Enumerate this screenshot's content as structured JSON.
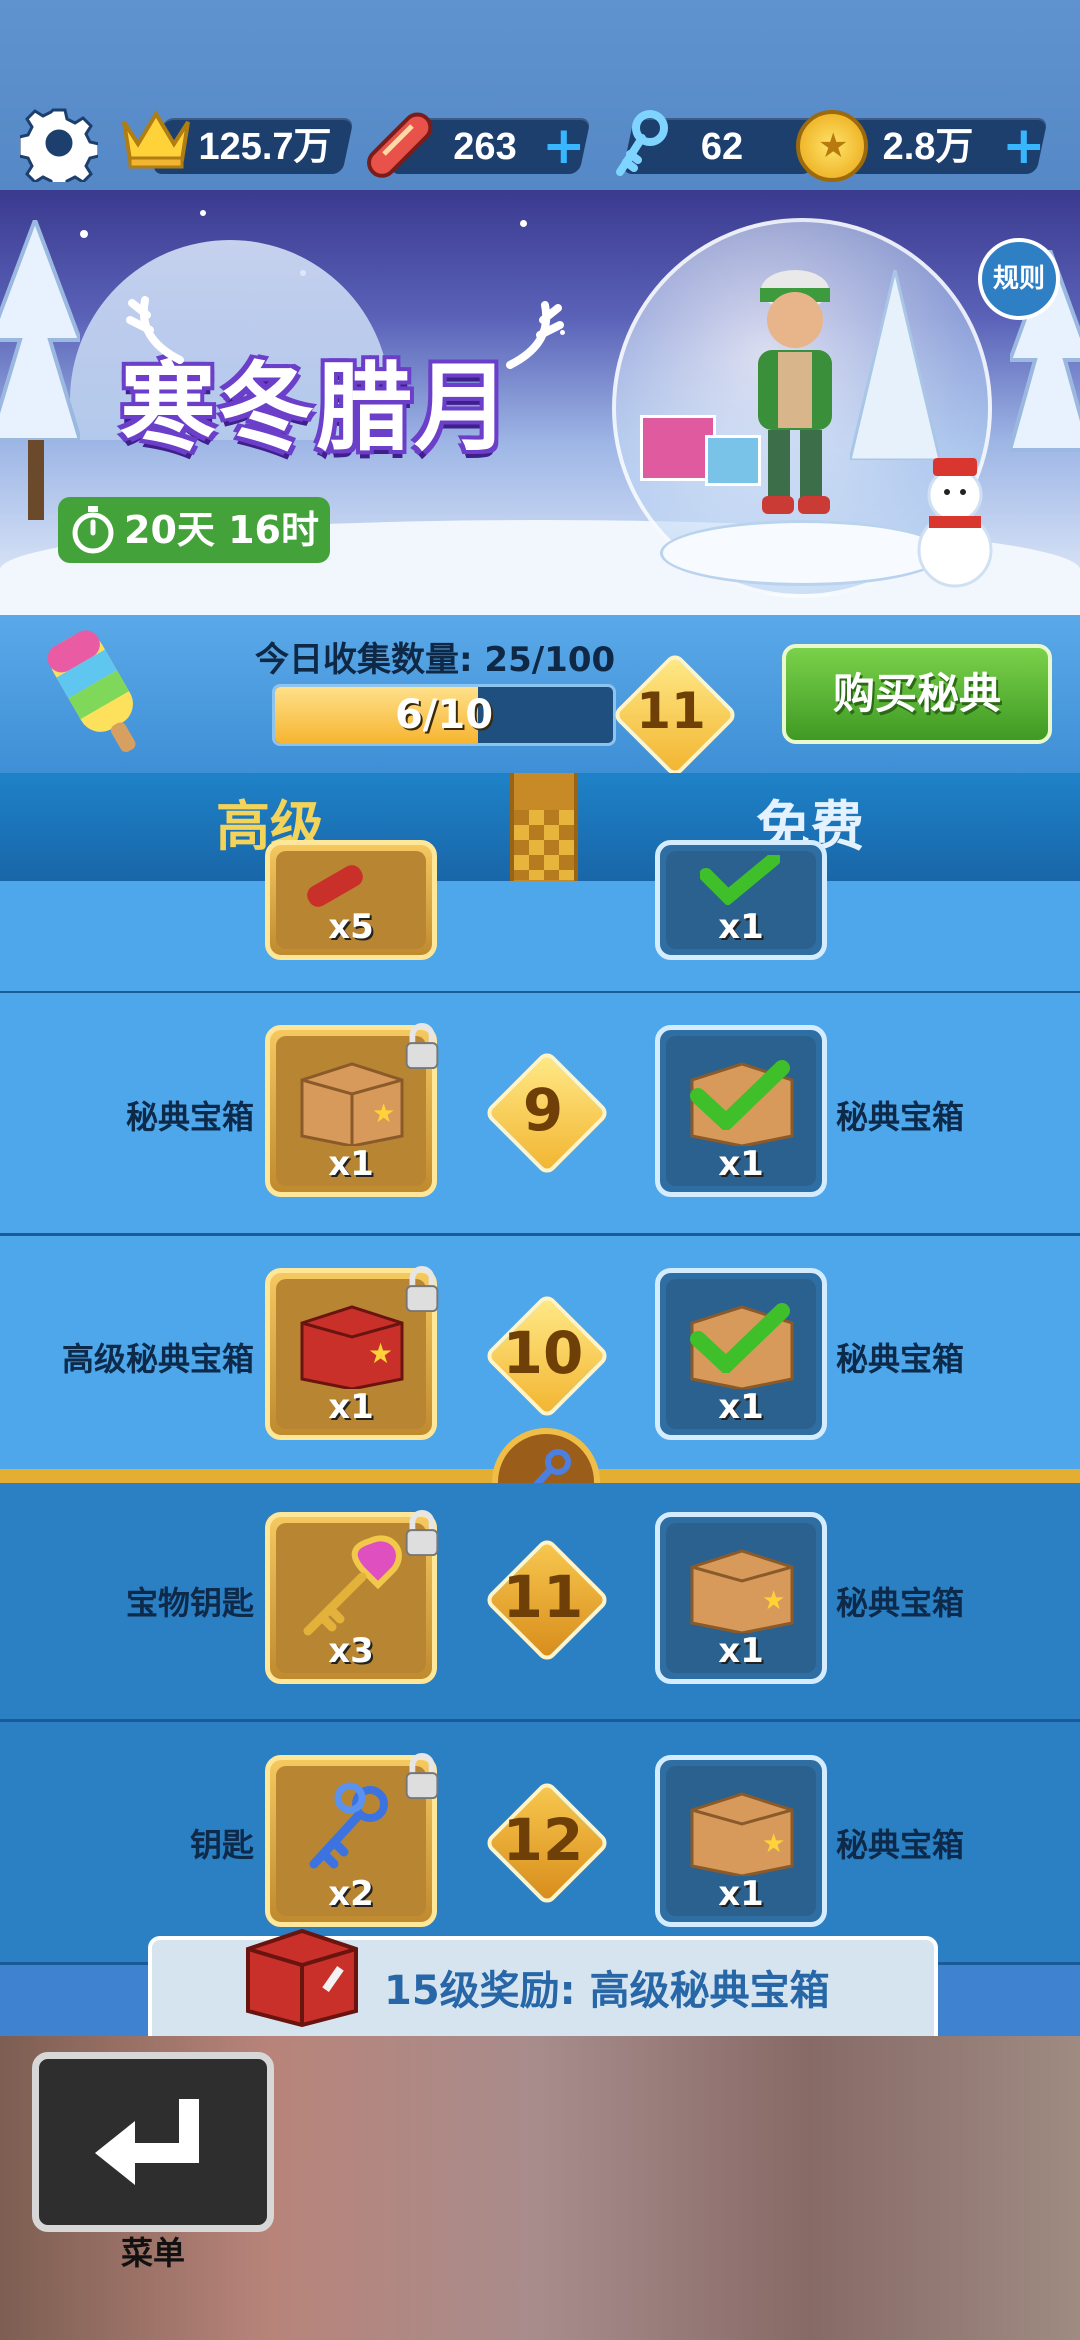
{
  "topbar": {
    "score": "125.7万",
    "boards": "263",
    "keys": "62",
    "coins": "2.8万",
    "plus": "+"
  },
  "event": {
    "title": "寒冬腊月",
    "timer": "20天 16时",
    "rules": "规则"
  },
  "progress": {
    "daily_label": "今日收集数量: 25/100",
    "bar_text": "6/10",
    "bar_fraction": 0.6,
    "current_level": "11",
    "buy_button": "购买秘典"
  },
  "tabs": {
    "premium": "高级",
    "free": "免费"
  },
  "rows": [
    {
      "level": "",
      "premium_label": "",
      "premium_qty": "x5",
      "free_label": "",
      "free_qty": "x1"
    },
    {
      "level": "9",
      "premium_label": "秘典宝箱",
      "premium_qty": "x1",
      "free_label": "秘典宝箱",
      "free_qty": "x1"
    },
    {
      "level": "10",
      "premium_label": "高级秘典宝箱",
      "premium_qty": "x1",
      "free_label": "秘典宝箱",
      "free_qty": "x1"
    },
    {
      "level": "11",
      "premium_label": "宝物钥匙",
      "premium_qty": "x3",
      "free_label": "秘典宝箱",
      "free_qty": "x1"
    },
    {
      "level": "12",
      "premium_label": "钥匙",
      "premium_qty": "x2",
      "free_label": "秘典宝箱",
      "free_qty": "x1"
    }
  ],
  "milestone": {
    "qty": "x5"
  },
  "bonus": {
    "text": "15级奖励: 高级秘典宝箱"
  },
  "menu": {
    "label": "菜单"
  },
  "colors": {
    "accent_green": "#43a23a",
    "rail": "#c88a27",
    "header_blue": "#1866a8"
  }
}
